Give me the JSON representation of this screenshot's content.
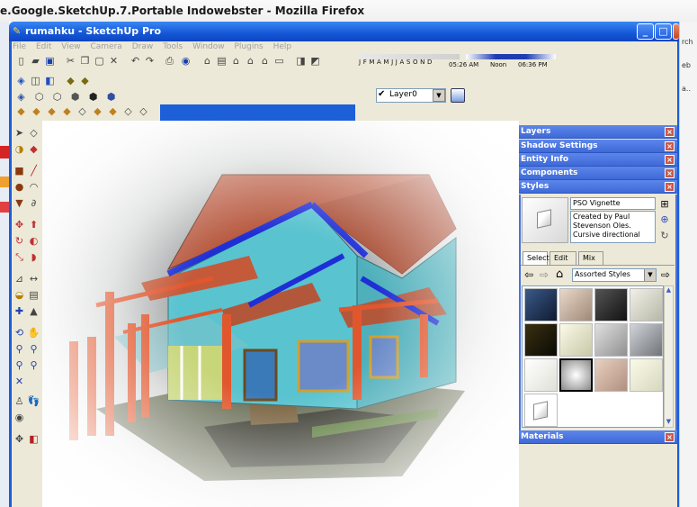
{
  "browser": {
    "title": "e.Google.SketchUp.7.Portable Indowebster - Mozilla Firefox",
    "right_margin_texts": [
      "rch",
      "eb",
      "a.."
    ]
  },
  "window": {
    "title": "rumahku - SketchUp Pro",
    "controls": [
      "_",
      "□",
      "X"
    ]
  },
  "menu": [
    "File",
    "Edit",
    "View",
    "Camera",
    "Draw",
    "Tools",
    "Window",
    "Plugins",
    "Help"
  ],
  "shadow_toolbar": {
    "months": "J F M A M J J A S O N D",
    "time_start": "05:26 AM",
    "time_mid": "Noon",
    "time_end": "06:36 PM"
  },
  "layers_toolbar": {
    "current_layer": "Layer0"
  },
  "panels": {
    "headers": [
      "Layers",
      "Shadow Settings",
      "Entity Info",
      "Components",
      "Styles",
      "Materials"
    ],
    "styles": {
      "name": "PSO Vignette",
      "description": "Created by Paul Stevenson Oles. Cursive directional",
      "tabs": [
        "Select",
        "Edit",
        "Mix"
      ],
      "collection": "Assorted Styles"
    }
  },
  "colors": {
    "titlebar": "#1457d6",
    "panel_header": "#4a73dc",
    "toolbar_bg": "#ece9d8",
    "roof": "#b7583e",
    "walls": "#59c3cf",
    "fascia": "#1f2fd6",
    "columns": "#e0572e"
  }
}
